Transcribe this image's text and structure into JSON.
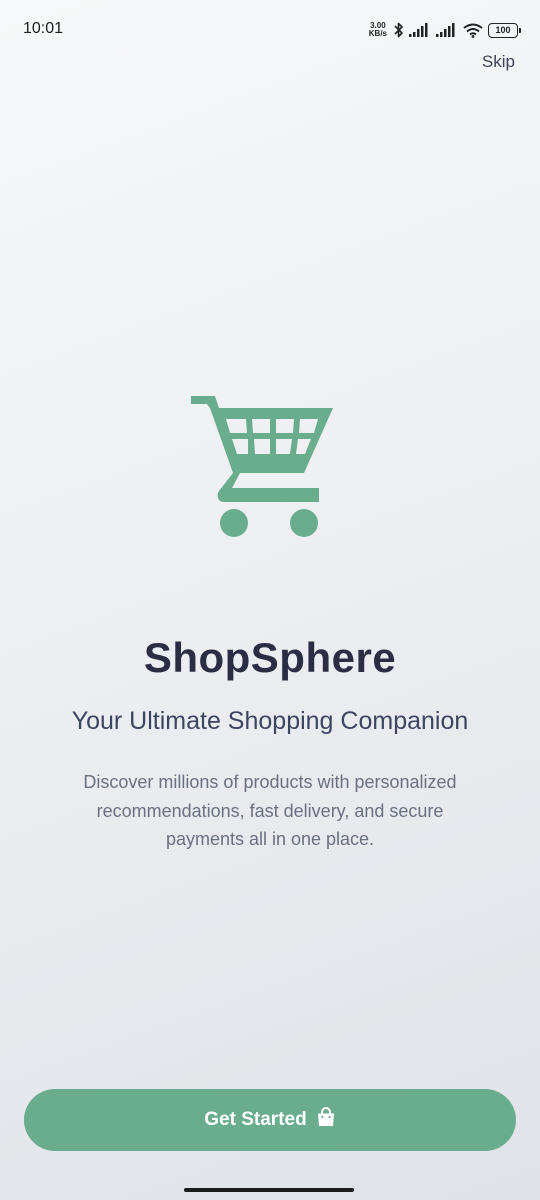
{
  "status_bar": {
    "time": "10:01",
    "net_speed_value": "3.00",
    "net_speed_unit": "KB/s",
    "battery": "100",
    "icons": [
      "bluetooth-icon",
      "signal-icon",
      "signal-icon",
      "wifi-icon",
      "battery-icon"
    ]
  },
  "header": {
    "skip_label": "Skip"
  },
  "hero": {
    "icon": "shopping-cart-icon",
    "icon_color": "#6aad8e",
    "title": "ShopSphere",
    "subtitle": "Your Ultimate Shopping Companion",
    "description": "Discover millions of products with personalized recommendations, fast delivery, and secure payments all in one place."
  },
  "cta": {
    "label": "Get Started",
    "icon": "shopping-bag-icon",
    "background": "#6aad8e"
  }
}
